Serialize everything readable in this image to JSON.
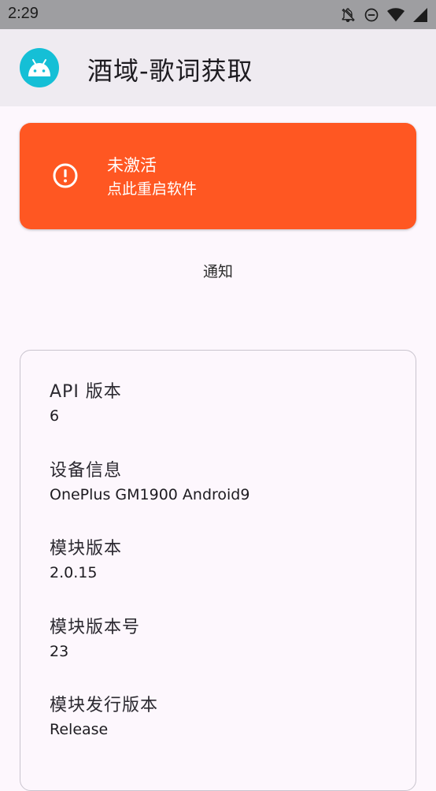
{
  "status_bar": {
    "time": "2:29",
    "icons": [
      "notifications-off-icon",
      "do-not-disturb-icon",
      "wifi-icon",
      "cellular-signal-icon"
    ]
  },
  "app_bar": {
    "icon": "android-robot-icon",
    "title": "酒域-歌词获取"
  },
  "alert": {
    "icon": "error-outline-icon",
    "title": "未激活",
    "subtitle": "点此重启软件",
    "color": "#ff5722"
  },
  "notify_button": {
    "label": "通知"
  },
  "info": {
    "items": [
      {
        "label": "API 版本",
        "value": "6"
      },
      {
        "label": "设备信息",
        "value": "OnePlus GM1900 Android9"
      },
      {
        "label": "模块版本",
        "value": "2.0.15"
      },
      {
        "label": "模块版本号",
        "value": "23"
      },
      {
        "label": "模块发行版本",
        "value": "Release"
      }
    ]
  }
}
